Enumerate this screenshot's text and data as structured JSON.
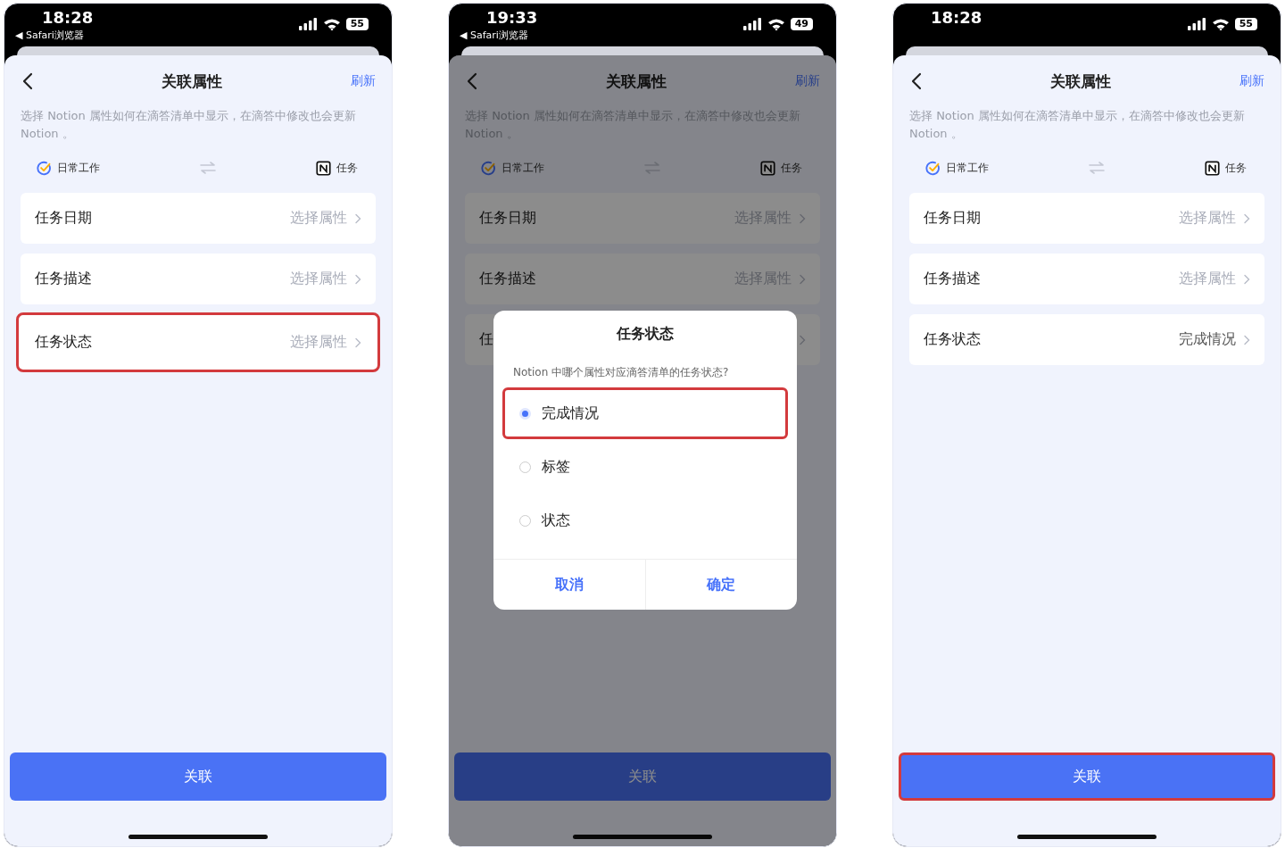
{
  "phones": [
    {
      "status_bar": {
        "time": "18:28",
        "back_label": "◀ Safari浏览器",
        "battery": "55"
      },
      "header": {
        "title": "关联属性",
        "action": "刷新"
      },
      "description": "选择 Notion 属性如何在滴答清单中显示，在滴答中修改也会更新 Notion 。",
      "mapping": {
        "source": "日常工作",
        "target": "任务"
      },
      "fields": [
        {
          "label": "任务日期",
          "value": "选择属性",
          "filled": false,
          "highlighted": false
        },
        {
          "label": "任务描述",
          "value": "选择属性",
          "filled": false,
          "highlighted": false
        },
        {
          "label": "任务状态",
          "value": "选择属性",
          "filled": false,
          "highlighted": true
        }
      ],
      "button": {
        "label": "关联",
        "highlighted": false
      },
      "dimmed": false
    },
    {
      "status_bar": {
        "time": "19:33",
        "back_label": "◀ Safari浏览器",
        "battery": "49"
      },
      "header": {
        "title": "关联属性",
        "action": "刷新"
      },
      "description": "选择 Notion 属性如何在滴答清单中显示，在滴答中修改也会更新 Notion 。",
      "mapping": {
        "source": "日常工作",
        "target": "任务"
      },
      "fields": [
        {
          "label": "任务日期",
          "value": "选择属性",
          "filled": false,
          "highlighted": false
        },
        {
          "label": "任务描述",
          "value": "选择属性",
          "filled": false,
          "highlighted": false
        },
        {
          "label": "任",
          "highlighted": false
        }
      ],
      "button": {
        "label": "关联",
        "highlighted": false
      },
      "dimmed": true,
      "dialog": {
        "title": "任务状态",
        "question": "Notion 中哪个属性对应滴答清单的任务状态?",
        "options": [
          {
            "label": "完成情况",
            "selected": true,
            "highlighted": true
          },
          {
            "label": "标签",
            "selected": false,
            "highlighted": false
          },
          {
            "label": "状态",
            "selected": false,
            "highlighted": false
          }
        ],
        "cancel": "取消",
        "confirm": "确定"
      }
    },
    {
      "status_bar": {
        "time": "18:28",
        "battery": "55"
      },
      "header": {
        "title": "关联属性",
        "action": "刷新"
      },
      "description": "选择 Notion 属性如何在滴答清单中显示，在滴答中修改也会更新 Notion 。",
      "mapping": {
        "source": "日常工作",
        "target": "任务"
      },
      "fields": [
        {
          "label": "任务日期",
          "value": "选择属性",
          "filled": false,
          "highlighted": false
        },
        {
          "label": "任务描述",
          "value": "选择属性",
          "filled": false,
          "highlighted": false
        },
        {
          "label": "任务状态",
          "value": "完成情况",
          "filled": true,
          "highlighted": false
        }
      ],
      "button": {
        "label": "关联",
        "highlighted": true
      },
      "dimmed": false
    }
  ]
}
